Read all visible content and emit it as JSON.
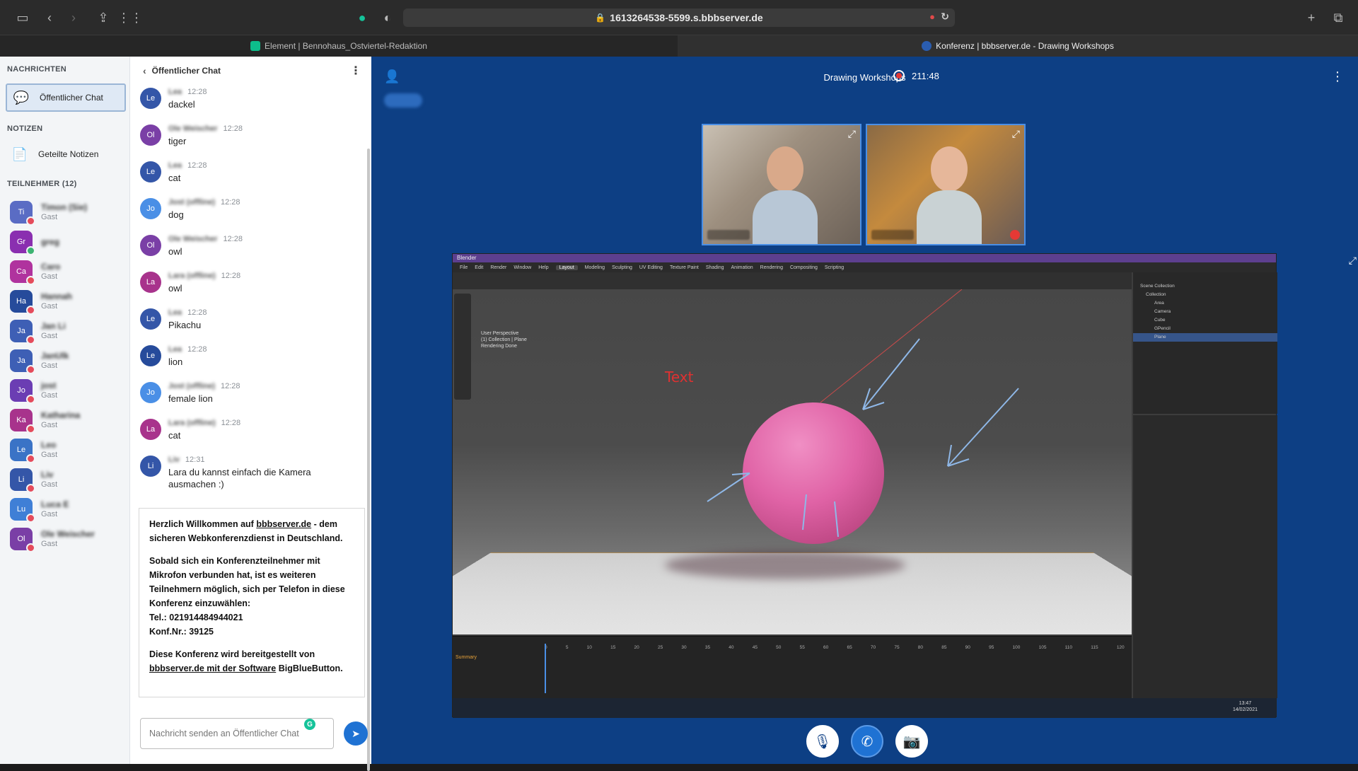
{
  "browser": {
    "url": "1613264538-5599.s.bbbserver.de",
    "tabs": [
      {
        "title": "Element | Bennohaus_Ostviertel-Redaktion"
      },
      {
        "title": "Konferenz | bbbserver.de - Drawing Workshops"
      }
    ]
  },
  "sidebar": {
    "messages_heading": "NACHRICHTEN",
    "public_chat_label": "Öffentlicher Chat",
    "notes_heading": "NOTIZEN",
    "shared_notes_label": "Geteilte Notizen",
    "participants_heading": "TEILNEHMER (12)",
    "participants": [
      {
        "initials": "Ti",
        "name": "Timon (Sie)",
        "role": "Gast",
        "color": "#5a6cc4"
      },
      {
        "initials": "Gr",
        "name": "greg",
        "role": "",
        "color": "#8a2fb0"
      },
      {
        "initials": "Ca",
        "name": "Caro",
        "role": "Gast",
        "color": "#b0339e"
      },
      {
        "initials": "Ha",
        "name": "Hannah",
        "role": "Gast",
        "color": "#264b9b"
      },
      {
        "initials": "Ja",
        "name": "Jan Li",
        "role": "Gast",
        "color": "#3e5fb5"
      },
      {
        "initials": "Ja",
        "name": "JanUlk",
        "role": "Gast",
        "color": "#3e5fb5"
      },
      {
        "initials": "Jo",
        "name": "jost",
        "role": "Gast",
        "color": "#6b3db3"
      },
      {
        "initials": "Ka",
        "name": "Katharina",
        "role": "Gast",
        "color": "#a8338c"
      },
      {
        "initials": "Le",
        "name": "Leo",
        "role": "Gast",
        "color": "#3a73c6"
      },
      {
        "initials": "Li",
        "name": "Liv",
        "role": "Gast",
        "color": "#3456a8"
      },
      {
        "initials": "Lu",
        "name": "Luca E",
        "role": "Gast",
        "color": "#3f7fd6"
      },
      {
        "initials": "Ol",
        "name": "Ole Weischer",
        "role": "Gast",
        "color": "#7a3fa6"
      }
    ]
  },
  "chat": {
    "title": "Öffentlicher Chat",
    "messages": [
      {
        "initials": "Le",
        "user": "Lea",
        "time": "12:28",
        "text": "dackel",
        "color": "#3456a8"
      },
      {
        "initials": "Ol",
        "user": "Ole Weischer",
        "time": "12:28",
        "text": "tiger",
        "color": "#7a3fa6"
      },
      {
        "initials": "Le",
        "user": "Lea",
        "time": "12:28",
        "text": "cat",
        "color": "#3456a8"
      },
      {
        "initials": "Jo",
        "user": "Jost (offline)",
        "time": "12:28",
        "text": "dog",
        "color": "#4a8fe6"
      },
      {
        "initials": "Ol",
        "user": "Ole Weischer",
        "time": "12:28",
        "text": "owl",
        "color": "#7a3fa6"
      },
      {
        "initials": "La",
        "user": "Lara (offline)",
        "time": "12:28",
        "text": "owl",
        "color": "#a8338c"
      },
      {
        "initials": "Le",
        "user": "Lea",
        "time": "12:28",
        "text": "Pikachu",
        "color": "#3456a8"
      },
      {
        "initials": "Le",
        "user": "Lea",
        "time": "12:28",
        "text": "lion",
        "color": "#264b9b"
      },
      {
        "initials": "Jo",
        "user": "Jost (offline)",
        "time": "12:28",
        "text": "female lion",
        "color": "#4a8fe6"
      },
      {
        "initials": "La",
        "user": "Lara (offline)",
        "time": "12:28",
        "text": "cat",
        "color": "#a8338c"
      },
      {
        "initials": "Li",
        "user": "Liv",
        "time": "12:31",
        "text": "Lara du kannst einfach die Kamera ausmachen :)",
        "color": "#3456a8"
      }
    ],
    "welcome": {
      "p1_a": "Herzlich Willkommen auf ",
      "p1_link": "bbbserver.de",
      "p1_b": " - dem sicheren Webkonferenzdienst in Deutschland.",
      "p2": "Sobald sich ein Konferenzteilnehmer mit Mikrofon verbunden hat, ist es weiteren Teilnehmern möglich, sich per Telefon in diese Konferenz einzuwählen:",
      "tel": "Tel.: 021914484944021",
      "conf": "Konf.Nr.: 39125",
      "p3_a": "Diese Konferenz wird bereitgestellt von ",
      "p3_link": "bbbserver.de mit der Software",
      "p3_b": " BigBlueButton."
    },
    "input_placeholder": "Nachricht senden an Öffentlicher Chat"
  },
  "conference": {
    "title": "Drawing Workshops",
    "recording_time": "211:48"
  },
  "blender": {
    "window_title": "Blender",
    "menus": [
      "File",
      "Edit",
      "Render",
      "Window",
      "Help"
    ],
    "workspaces": [
      "Layout",
      "Modeling",
      "Sculpting",
      "UV Editing",
      "Texture Paint",
      "Shading",
      "Animation",
      "Rendering",
      "Compositing",
      "Scripting"
    ],
    "viewport_info": [
      "User Perspective",
      "(1) Collection | Plane",
      "Rendering Done"
    ],
    "viewport_text": "Text",
    "outliner_items": [
      "Scene Collection",
      "Collection",
      "Area",
      "Camera",
      "Cube",
      "GPencil",
      "Plane"
    ],
    "timeline_ticks": [
      "0",
      "5",
      "10",
      "15",
      "20",
      "25",
      "30",
      "35",
      "40",
      "45",
      "50",
      "55",
      "60",
      "65",
      "70",
      "75",
      "80",
      "85",
      "90",
      "95",
      "100",
      "105",
      "110",
      "115",
      "120"
    ],
    "timeline_summary": "Summary",
    "clock": "13:47",
    "date": "14/02/2021"
  }
}
